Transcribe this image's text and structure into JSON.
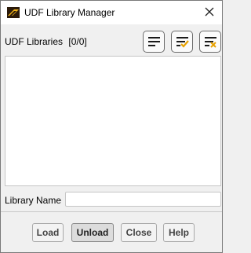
{
  "window": {
    "title": "UDF Library Manager"
  },
  "libraries": {
    "label": "UDF Libraries",
    "count": "[0/0]",
    "items": [],
    "toolbar": [
      "select-all-icon",
      "select-checked-icon",
      "deselect-all-icon"
    ]
  },
  "library_name": {
    "label": "Library Name",
    "value": ""
  },
  "buttons": {
    "load": "Load",
    "unload": "Unload",
    "close": "Close",
    "help": "Help"
  },
  "colors": {
    "check_accent": "#e8a200",
    "clear_accent": "#e8a200",
    "icon_lines": "#1a1a1a"
  }
}
